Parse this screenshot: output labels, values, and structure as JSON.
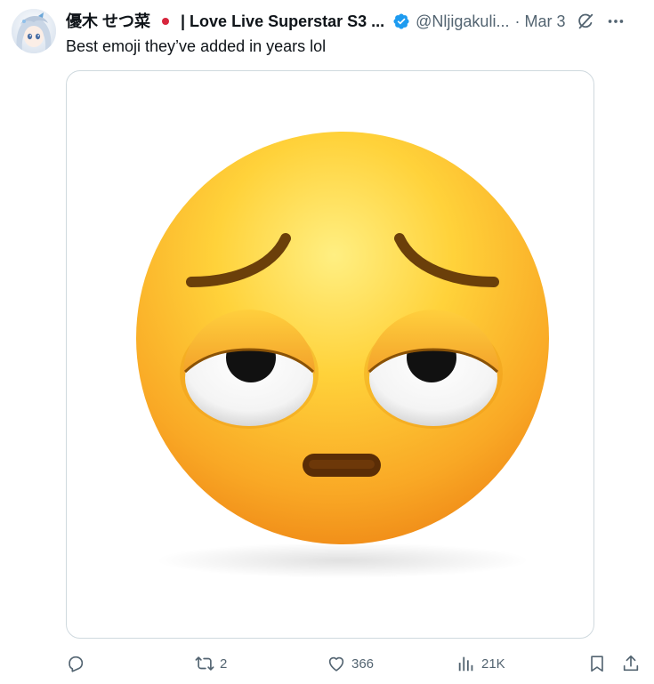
{
  "tweet": {
    "author": {
      "display_name_part1": "優木 せつ菜",
      "display_name_part2": "| Love Live Superstar S3 ...",
      "handle": "@Nljigakuli...",
      "verified": true
    },
    "separator": "·",
    "date": "Mar 3",
    "text": "Best emoji they’ve added in years lol",
    "metrics": {
      "replies": "",
      "retweets": "2",
      "likes": "366",
      "views": "21K"
    }
  },
  "colors": {
    "verified_blue": "#1d9bf0",
    "secondary_text": "#536471",
    "primary_text": "#0f1419",
    "card_border": "#cfd9de",
    "flag_red": "#d7263d"
  },
  "icons": {
    "flag": "japan-flag-icon",
    "verified": "verified-badge-icon",
    "grok": "grok-icon",
    "more": "more-icon",
    "reply": "reply-icon",
    "retweet": "retweet-icon",
    "like": "heart-icon",
    "views": "views-icon",
    "bookmark": "bookmark-icon",
    "share": "share-icon"
  }
}
